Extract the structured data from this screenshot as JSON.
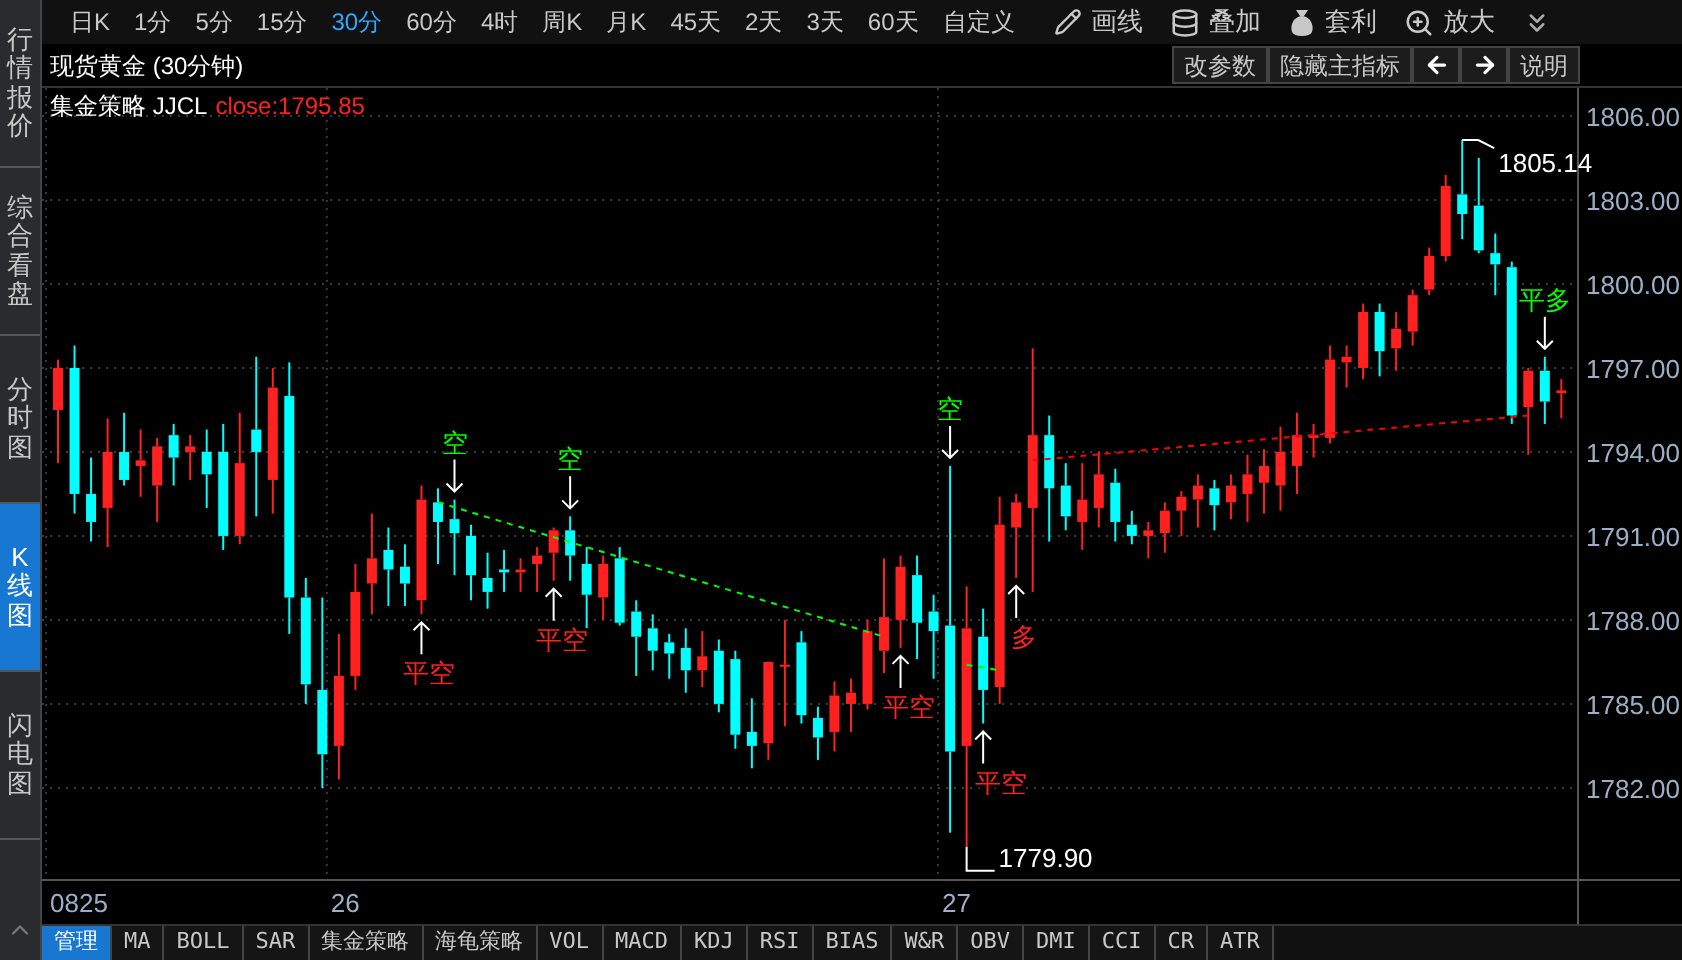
{
  "sidebar": {
    "items": [
      {
        "label": "行情报价",
        "selected": false
      },
      {
        "label": "综合看盘",
        "selected": false
      },
      {
        "label": "分时图",
        "selected": false
      },
      {
        "label": "K线图",
        "selected": true
      },
      {
        "label": "闪电图",
        "selected": false
      }
    ]
  },
  "toolbar": {
    "periods": [
      {
        "label": "日K",
        "selected": false
      },
      {
        "label": "1分",
        "selected": false
      },
      {
        "label": "5分",
        "selected": false
      },
      {
        "label": "15分",
        "selected": false
      },
      {
        "label": "30分",
        "selected": true
      },
      {
        "label": "60分",
        "selected": false
      },
      {
        "label": "4时",
        "selected": false
      },
      {
        "label": "周K",
        "selected": false
      },
      {
        "label": "月K",
        "selected": false
      },
      {
        "label": "45天",
        "selected": false
      },
      {
        "label": "2天",
        "selected": false
      },
      {
        "label": "3天",
        "selected": false
      },
      {
        "label": "60天",
        "selected": false
      },
      {
        "label": "自定义",
        "selected": false
      }
    ],
    "tools": [
      {
        "label": "画线",
        "kind": "pencil"
      },
      {
        "label": "叠加",
        "kind": "stack"
      },
      {
        "label": "套利",
        "kind": "bag"
      },
      {
        "label": "放大",
        "kind": "zoom"
      }
    ]
  },
  "header": {
    "title": "现货黄金 (30分钟)",
    "buttons": [
      {
        "kind": "text",
        "label": "改参数"
      },
      {
        "kind": "text",
        "label": "隐藏主指标"
      },
      {
        "kind": "left"
      },
      {
        "kind": "right"
      },
      {
        "kind": "text",
        "label": "说明"
      }
    ]
  },
  "indicator": {
    "name": "集金策略 JJCL",
    "reading": "close:1795.85"
  },
  "chart": {
    "chart_data": {
      "type": "candlestick",
      "grid": true,
      "ylim": [
        1778.71,
        1807
      ],
      "categories": [
        null,
        null,
        null,
        null,
        null,
        null,
        null,
        null,
        null,
        null,
        null,
        null,
        null,
        null,
        null,
        null,
        null,
        null,
        null,
        null,
        null,
        null,
        null,
        null,
        null,
        null,
        null,
        null,
        null,
        null,
        null,
        null,
        null,
        null,
        null,
        null,
        null,
        null,
        null,
        null,
        null,
        null,
        null,
        null,
        null,
        null,
        null,
        null,
        null,
        null,
        null,
        null,
        null,
        null,
        null,
        null,
        null,
        null,
        null,
        null,
        null,
        null,
        null,
        null,
        null,
        null,
        null,
        null,
        null,
        null,
        null,
        null,
        null,
        null,
        null,
        null,
        null,
        null,
        null,
        null,
        null,
        null,
        null,
        null,
        null,
        null,
        null,
        null,
        null,
        null,
        null,
        null
      ],
      "yticks": [
        {
          "value": 1782,
          "label": "1782.00"
        },
        {
          "value": 1785,
          "label": "1785.00"
        },
        {
          "value": 1788,
          "label": "1788.00"
        },
        {
          "value": 1791,
          "label": "1791.00"
        },
        {
          "value": 1794,
          "label": "1794.00"
        },
        {
          "value": 1797,
          "label": "1797.00"
        },
        {
          "value": 1800,
          "label": "1800.00"
        },
        {
          "value": 1803,
          "label": "1803.00"
        },
        {
          "value": 1806,
          "label": "1806.00"
        }
      ],
      "ohlc": [
        [
          1795.5,
          1797.3,
          1793.6,
          1797.0
        ],
        [
          1797.0,
          1797.8,
          1791.8,
          1792.5
        ],
        [
          1792.5,
          1793.8,
          1790.8,
          1791.5
        ],
        [
          1792.0,
          1795.2,
          1790.6,
          1794.0
        ],
        [
          1794.0,
          1795.4,
          1792.8,
          1793.0
        ],
        [
          1793.5,
          1794.8,
          1792.4,
          1793.7
        ],
        [
          1792.8,
          1794.5,
          1791.5,
          1794.2
        ],
        [
          1794.6,
          1795.0,
          1792.8,
          1793.8
        ],
        [
          1794.0,
          1794.6,
          1793.0,
          1794.2
        ],
        [
          1794.0,
          1794.8,
          1792.0,
          1793.2
        ],
        [
          1794.0,
          1795.0,
          1790.5,
          1791.0
        ],
        [
          1791.0,
          1795.4,
          1790.7,
          1793.6
        ],
        [
          1794.8,
          1797.4,
          1791.7,
          1794.0
        ],
        [
          1793.0,
          1797.0,
          1791.8,
          1796.3
        ],
        [
          1796.0,
          1797.2,
          1787.5,
          1788.8
        ],
        [
          1788.8,
          1789.5,
          1785.0,
          1785.7
        ],
        [
          1785.5,
          1788.8,
          1782.0,
          1783.2
        ],
        [
          1783.5,
          1787.5,
          1782.3,
          1786.0
        ],
        [
          1786.0,
          1790.0,
          1785.5,
          1789.0
        ],
        [
          1789.3,
          1791.8,
          1788.2,
          1790.2
        ],
        [
          1790.5,
          1791.3,
          1788.5,
          1789.8
        ],
        [
          1789.9,
          1790.7,
          1788.5,
          1789.3
        ],
        [
          1788.7,
          1792.8,
          1788.2,
          1792.3
        ],
        [
          1792.2,
          1792.7,
          1790.0,
          1791.5
        ],
        [
          1791.6,
          1792.3,
          1789.6,
          1791.1
        ],
        [
          1791.0,
          1791.4,
          1788.7,
          1789.6
        ],
        [
          1789.5,
          1790.4,
          1788.4,
          1789.0
        ],
        [
          1789.8,
          1790.5,
          1789.0,
          1789.7
        ],
        [
          1789.7,
          1790.2,
          1789.0,
          1789.8
        ],
        [
          1790.0,
          1790.6,
          1789.0,
          1790.3
        ],
        [
          1790.4,
          1791.3,
          1789.4,
          1791.2
        ],
        [
          1791.2,
          1791.7,
          1789.4,
          1790.3
        ],
        [
          1790.0,
          1790.6,
          1787.6,
          1788.9
        ],
        [
          1788.8,
          1790.3,
          1788.0,
          1790.0
        ],
        [
          1790.2,
          1790.6,
          1787.8,
          1787.9
        ],
        [
          1788.3,
          1788.7,
          1786.0,
          1787.4
        ],
        [
          1787.7,
          1788.2,
          1786.2,
          1786.9
        ],
        [
          1787.2,
          1787.5,
          1785.9,
          1786.8
        ],
        [
          1787.0,
          1787.7,
          1785.4,
          1786.2
        ],
        [
          1786.2,
          1787.6,
          1785.6,
          1786.7
        ],
        [
          1786.9,
          1787.3,
          1784.7,
          1785.0
        ],
        [
          1786.6,
          1786.9,
          1783.4,
          1783.9
        ],
        [
          1784.0,
          1785.2,
          1782.7,
          1783.5
        ],
        [
          1783.6,
          1786.5,
          1783.0,
          1786.5
        ],
        [
          1786.4,
          1788.0,
          1784.2,
          1786.4
        ],
        [
          1787.2,
          1787.6,
          1784.3,
          1784.6
        ],
        [
          1784.5,
          1784.9,
          1783.0,
          1783.8
        ],
        [
          1784.0,
          1785.8,
          1783.3,
          1785.3
        ],
        [
          1785.0,
          1785.9,
          1784.0,
          1785.4
        ],
        [
          1785.0,
          1788.0,
          1784.8,
          1787.6
        ],
        [
          1786.9,
          1790.2,
          1786.1,
          1788.1
        ],
        [
          1788.0,
          1790.3,
          1787.0,
          1789.9
        ],
        [
          1789.6,
          1790.3,
          1786.6,
          1787.9
        ],
        [
          1788.3,
          1788.9,
          1785.9,
          1787.6
        ],
        [
          1787.8,
          1793.5,
          1780.4,
          1783.3
        ],
        [
          1783.5,
          1789.2,
          1779.9,
          1787.7
        ],
        [
          1787.4,
          1788.4,
          1784.3,
          1785.5
        ],
        [
          1785.6,
          1792.4,
          1785.0,
          1791.4
        ],
        [
          1791.3,
          1792.5,
          1789.5,
          1792.2
        ],
        [
          1792.0,
          1797.7,
          1789.0,
          1794.6
        ],
        [
          1794.6,
          1795.3,
          1790.8,
          1792.7
        ],
        [
          1792.8,
          1793.6,
          1791.2,
          1791.7
        ],
        [
          1791.5,
          1793.6,
          1790.5,
          1792.3
        ],
        [
          1792.0,
          1794.0,
          1791.3,
          1793.2
        ],
        [
          1792.9,
          1793.4,
          1790.8,
          1791.5
        ],
        [
          1791.4,
          1791.9,
          1790.7,
          1791.0
        ],
        [
          1791.0,
          1791.5,
          1790.2,
          1791.2
        ],
        [
          1791.1,
          1792.2,
          1790.4,
          1791.9
        ],
        [
          1791.9,
          1792.6,
          1791.0,
          1792.4
        ],
        [
          1792.3,
          1793.2,
          1791.3,
          1792.8
        ],
        [
          1792.7,
          1793.0,
          1791.2,
          1792.1
        ],
        [
          1792.2,
          1793.2,
          1791.6,
          1792.8
        ],
        [
          1792.5,
          1793.9,
          1791.5,
          1793.2
        ],
        [
          1792.9,
          1794.1,
          1791.8,
          1793.5
        ],
        [
          1792.8,
          1794.9,
          1791.9,
          1794.0
        ],
        [
          1793.5,
          1795.4,
          1792.5,
          1794.6
        ],
        [
          1794.5,
          1795.0,
          1793.8,
          1794.6
        ],
        [
          1794.5,
          1797.8,
          1794.3,
          1797.3
        ],
        [
          1797.2,
          1797.8,
          1796.3,
          1797.4
        ],
        [
          1797.0,
          1799.3,
          1796.6,
          1799.0
        ],
        [
          1799.0,
          1799.3,
          1796.7,
          1797.6
        ],
        [
          1797.7,
          1799.0,
          1796.9,
          1798.4
        ],
        [
          1798.3,
          1799.8,
          1797.8,
          1799.6
        ],
        [
          1799.8,
          1801.3,
          1799.6,
          1801.0
        ],
        [
          1801.0,
          1803.9,
          1800.8,
          1803.5
        ],
        [
          1803.2,
          1805.14,
          1801.6,
          1802.5
        ],
        [
          1802.8,
          1804.5,
          1801.1,
          1801.2
        ],
        [
          1801.1,
          1801.8,
          1799.6,
          1800.7
        ],
        [
          1800.6,
          1800.8,
          1795.0,
          1795.3
        ],
        [
          1795.6,
          1797.0,
          1793.9,
          1796.9
        ],
        [
          1796.9,
          1797.4,
          1795.0,
          1795.8
        ],
        [
          1796.1,
          1796.6,
          1795.2,
          1796.2
        ]
      ],
      "annotations": [
        "1805.14",
        "平多",
        "空",
        "空",
        "空",
        "多",
        "平空",
        "平空",
        "平空",
        "平空",
        "1779.90"
      ]
    },
    "date_labels": [
      "0825",
      "26",
      "27"
    ]
  },
  "bottom_tabs": [
    {
      "label": "管理",
      "selected": true
    },
    {
      "label": "MA",
      "selected": false
    },
    {
      "label": "BOLL",
      "selected": false
    },
    {
      "label": "SAR",
      "selected": false
    },
    {
      "label": "集金策略",
      "selected": false
    },
    {
      "label": "海龟策略",
      "selected": false
    },
    {
      "label": "VOL",
      "selected": false
    },
    {
      "label": "MACD",
      "selected": false
    },
    {
      "label": "KDJ",
      "selected": false
    },
    {
      "label": "RSI",
      "selected": false
    },
    {
      "label": "BIAS",
      "selected": false
    },
    {
      "label": "W&R",
      "selected": false
    },
    {
      "label": "OBV",
      "selected": false
    },
    {
      "label": "DMI",
      "selected": false
    },
    {
      "label": "CCI",
      "selected": false
    },
    {
      "label": "CR",
      "selected": false
    },
    {
      "label": "ATR",
      "selected": false
    }
  ]
}
